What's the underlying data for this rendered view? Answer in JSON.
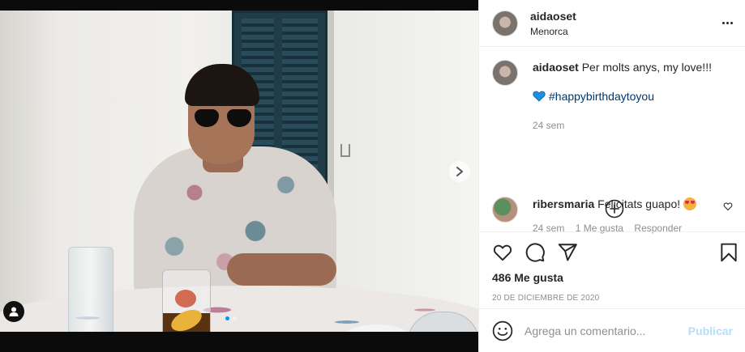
{
  "post": {
    "username": "aidaoset",
    "location": "Menorca"
  },
  "caption": {
    "username": "aidaoset",
    "text": "Per molts anys, my love!!!",
    "hashtag": "#happybirthdaytoyou",
    "time": "24 sem"
  },
  "comments": [
    {
      "username": "ribersmaria",
      "text": "Felicitats guapo!",
      "time": "24 sem",
      "likes": "1 Me gusta",
      "reply": "Responder"
    }
  ],
  "actions": {
    "likes_count": "486 Me gusta",
    "date": "20 DE DICIEMBRE DE 2020"
  },
  "add_comment": {
    "placeholder": "Agrega un comentario...",
    "publish_label": "Publicar"
  },
  "carousel": {
    "slide_count": 2,
    "active_index": 0
  },
  "colors": {
    "accent": "#0095f6",
    "link": "#00376b",
    "publish_disabled": "#b2dffc",
    "secondary_text": "#8e8e8e"
  },
  "icons": {
    "more": "more-horizontal-icon",
    "load_more": "plus-circle-icon",
    "like": "heart-icon",
    "comment": "comment-icon",
    "share": "send-icon",
    "save": "bookmark-icon",
    "emoji": "smile-icon",
    "next": "chevron-right-icon",
    "tags": "user-icon"
  }
}
